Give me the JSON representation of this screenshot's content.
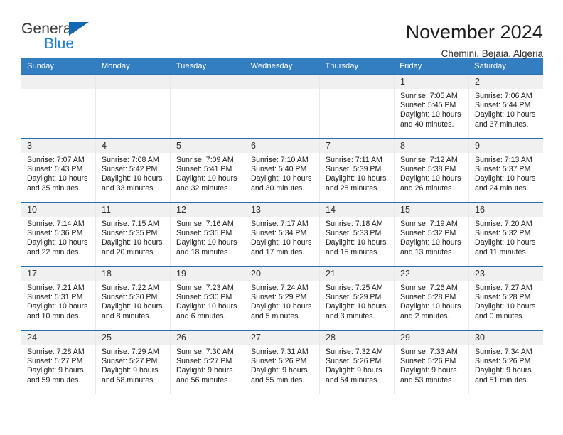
{
  "logo": {
    "word_one": "General",
    "word_two": "Blue",
    "triangle_color": "#1268b3",
    "blue_text_color": "#1b7fd4"
  },
  "header": {
    "title": "November 2024",
    "subtitle": "Chemini, Bejaia, Algeria"
  },
  "theme": {
    "header_blue": "#337ec0",
    "row_divider_blue": "#2a70ad",
    "day_band_gray": "#f0f0f0"
  },
  "weekdays": [
    "Sunday",
    "Monday",
    "Tuesday",
    "Wednesday",
    "Thursday",
    "Friday",
    "Saturday"
  ],
  "weeks": [
    [
      {
        "day": "",
        "lines": []
      },
      {
        "day": "",
        "lines": []
      },
      {
        "day": "",
        "lines": []
      },
      {
        "day": "",
        "lines": []
      },
      {
        "day": "",
        "lines": []
      },
      {
        "day": "1",
        "lines": [
          "Sunrise: 7:05 AM",
          "Sunset: 5:45 PM",
          "Daylight: 10 hours",
          "and 40 minutes."
        ]
      },
      {
        "day": "2",
        "lines": [
          "Sunrise: 7:06 AM",
          "Sunset: 5:44 PM",
          "Daylight: 10 hours",
          "and 37 minutes."
        ]
      }
    ],
    [
      {
        "day": "3",
        "lines": [
          "Sunrise: 7:07 AM",
          "Sunset: 5:43 PM",
          "Daylight: 10 hours",
          "and 35 minutes."
        ]
      },
      {
        "day": "4",
        "lines": [
          "Sunrise: 7:08 AM",
          "Sunset: 5:42 PM",
          "Daylight: 10 hours",
          "and 33 minutes."
        ]
      },
      {
        "day": "5",
        "lines": [
          "Sunrise: 7:09 AM",
          "Sunset: 5:41 PM",
          "Daylight: 10 hours",
          "and 32 minutes."
        ]
      },
      {
        "day": "6",
        "lines": [
          "Sunrise: 7:10 AM",
          "Sunset: 5:40 PM",
          "Daylight: 10 hours",
          "and 30 minutes."
        ]
      },
      {
        "day": "7",
        "lines": [
          "Sunrise: 7:11 AM",
          "Sunset: 5:39 PM",
          "Daylight: 10 hours",
          "and 28 minutes."
        ]
      },
      {
        "day": "8",
        "lines": [
          "Sunrise: 7:12 AM",
          "Sunset: 5:38 PM",
          "Daylight: 10 hours",
          "and 26 minutes."
        ]
      },
      {
        "day": "9",
        "lines": [
          "Sunrise: 7:13 AM",
          "Sunset: 5:37 PM",
          "Daylight: 10 hours",
          "and 24 minutes."
        ]
      }
    ],
    [
      {
        "day": "10",
        "lines": [
          "Sunrise: 7:14 AM",
          "Sunset: 5:36 PM",
          "Daylight: 10 hours",
          "and 22 minutes."
        ]
      },
      {
        "day": "11",
        "lines": [
          "Sunrise: 7:15 AM",
          "Sunset: 5:35 PM",
          "Daylight: 10 hours",
          "and 20 minutes."
        ]
      },
      {
        "day": "12",
        "lines": [
          "Sunrise: 7:16 AM",
          "Sunset: 5:35 PM",
          "Daylight: 10 hours",
          "and 18 minutes."
        ]
      },
      {
        "day": "13",
        "lines": [
          "Sunrise: 7:17 AM",
          "Sunset: 5:34 PM",
          "Daylight: 10 hours",
          "and 17 minutes."
        ]
      },
      {
        "day": "14",
        "lines": [
          "Sunrise: 7:18 AM",
          "Sunset: 5:33 PM",
          "Daylight: 10 hours",
          "and 15 minutes."
        ]
      },
      {
        "day": "15",
        "lines": [
          "Sunrise: 7:19 AM",
          "Sunset: 5:32 PM",
          "Daylight: 10 hours",
          "and 13 minutes."
        ]
      },
      {
        "day": "16",
        "lines": [
          "Sunrise: 7:20 AM",
          "Sunset: 5:32 PM",
          "Daylight: 10 hours",
          "and 11 minutes."
        ]
      }
    ],
    [
      {
        "day": "17",
        "lines": [
          "Sunrise: 7:21 AM",
          "Sunset: 5:31 PM",
          "Daylight: 10 hours",
          "and 10 minutes."
        ]
      },
      {
        "day": "18",
        "lines": [
          "Sunrise: 7:22 AM",
          "Sunset: 5:30 PM",
          "Daylight: 10 hours",
          "and 8 minutes."
        ]
      },
      {
        "day": "19",
        "lines": [
          "Sunrise: 7:23 AM",
          "Sunset: 5:30 PM",
          "Daylight: 10 hours",
          "and 6 minutes."
        ]
      },
      {
        "day": "20",
        "lines": [
          "Sunrise: 7:24 AM",
          "Sunset: 5:29 PM",
          "Daylight: 10 hours",
          "and 5 minutes."
        ]
      },
      {
        "day": "21",
        "lines": [
          "Sunrise: 7:25 AM",
          "Sunset: 5:29 PM",
          "Daylight: 10 hours",
          "and 3 minutes."
        ]
      },
      {
        "day": "22",
        "lines": [
          "Sunrise: 7:26 AM",
          "Sunset: 5:28 PM",
          "Daylight: 10 hours",
          "and 2 minutes."
        ]
      },
      {
        "day": "23",
        "lines": [
          "Sunrise: 7:27 AM",
          "Sunset: 5:28 PM",
          "Daylight: 10 hours",
          "and 0 minutes."
        ]
      }
    ],
    [
      {
        "day": "24",
        "lines": [
          "Sunrise: 7:28 AM",
          "Sunset: 5:27 PM",
          "Daylight: 9 hours",
          "and 59 minutes."
        ]
      },
      {
        "day": "25",
        "lines": [
          "Sunrise: 7:29 AM",
          "Sunset: 5:27 PM",
          "Daylight: 9 hours",
          "and 58 minutes."
        ]
      },
      {
        "day": "26",
        "lines": [
          "Sunrise: 7:30 AM",
          "Sunset: 5:27 PM",
          "Daylight: 9 hours",
          "and 56 minutes."
        ]
      },
      {
        "day": "27",
        "lines": [
          "Sunrise: 7:31 AM",
          "Sunset: 5:26 PM",
          "Daylight: 9 hours",
          "and 55 minutes."
        ]
      },
      {
        "day": "28",
        "lines": [
          "Sunrise: 7:32 AM",
          "Sunset: 5:26 PM",
          "Daylight: 9 hours",
          "and 54 minutes."
        ]
      },
      {
        "day": "29",
        "lines": [
          "Sunrise: 7:33 AM",
          "Sunset: 5:26 PM",
          "Daylight: 9 hours",
          "and 53 minutes."
        ]
      },
      {
        "day": "30",
        "lines": [
          "Sunrise: 7:34 AM",
          "Sunset: 5:26 PM",
          "Daylight: 9 hours",
          "and 51 minutes."
        ]
      }
    ]
  ]
}
